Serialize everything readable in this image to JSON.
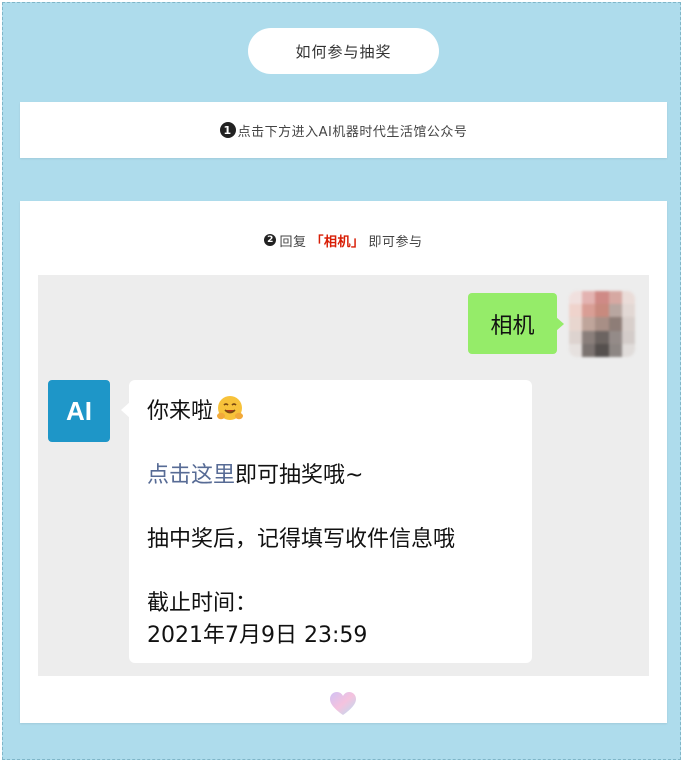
{
  "title": "如何参与抽奖",
  "step1": {
    "number": "1",
    "text": "点击下方进入AI机器时代生活馆公众号"
  },
  "step2": {
    "number": "2",
    "before": "回复",
    "keyword": "「相机」",
    "after": "即可参与"
  },
  "chat": {
    "user_message": "相机",
    "ai_avatar_text": "AI",
    "reply": {
      "greeting": "你来啦",
      "link_text": "点击这里",
      "link_suffix": "即可抽奖哦~",
      "line3": "抽中奖后，记得填写收件信息哦",
      "deadline_label": "截止时间：",
      "deadline_value": "2021年7月9日 23:59"
    }
  },
  "icons": {
    "emoji": "hugging-face-icon",
    "footer": "heart-icon"
  },
  "colors": {
    "background": "#aedcec",
    "keyword": "#d81e06",
    "user_bubble": "#95ec69",
    "ai_avatar": "#1e96c8",
    "link": "#576b95"
  }
}
